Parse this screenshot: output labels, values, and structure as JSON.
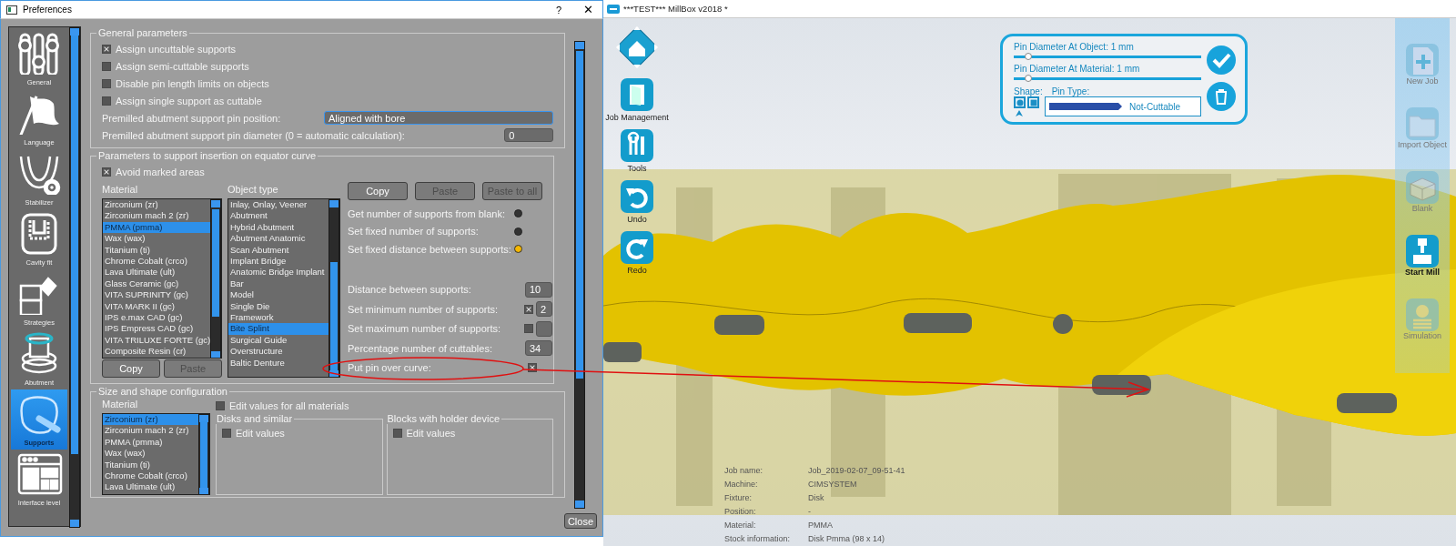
{
  "preferences": {
    "title": "Preferences",
    "help_button": "?",
    "close_button": "✕",
    "sidebar": [
      {
        "label": "General",
        "selected": false
      },
      {
        "label": "Language",
        "selected": false
      },
      {
        "label": "Stabilizer",
        "selected": false
      },
      {
        "label": "Cavity fit",
        "selected": false
      },
      {
        "label": "Strategies",
        "selected": false
      },
      {
        "label": "Abutment",
        "selected": false
      },
      {
        "label": "Supports",
        "selected": true
      },
      {
        "label": "Interface level",
        "selected": false
      }
    ],
    "general_parameters": {
      "title": "General parameters",
      "options": [
        {
          "label": "Assign uncuttable supports",
          "checked": true
        },
        {
          "label": "Assign semi-cuttable supports",
          "checked": false
        },
        {
          "label": "Disable pin length limits on objects",
          "checked": false
        },
        {
          "label": "Assign single support as cuttable",
          "checked": false
        }
      ],
      "pin_position": {
        "label": "Premilled abutment support pin position:",
        "value": "Aligned with bore"
      },
      "pin_diameter": {
        "label": "Premilled abutment support pin diameter (0 = automatic calculation):",
        "value": "0"
      }
    },
    "equator_curve": {
      "title": "Parameters to support insertion on equator curve",
      "avoid_marked_areas": {
        "label": "Avoid marked areas",
        "checked": true
      },
      "material": {
        "heading": "Material",
        "items": [
          {
            "label": "Zirconium (zr)",
            "selected": false
          },
          {
            "label": "Zirconium mach 2 (zr)",
            "selected": false
          },
          {
            "label": "PMMA (pmma)",
            "selected": true
          },
          {
            "label": "Wax (wax)",
            "selected": false
          },
          {
            "label": "Titanium (ti)",
            "selected": false
          },
          {
            "label": "Chrome Cobalt (crco)",
            "selected": false
          },
          {
            "label": "Lava Ultimate (ult)",
            "selected": false
          },
          {
            "label": "Glass Ceramic (gc)",
            "selected": false
          },
          {
            "label": "VITA SUPRINITY (gc)",
            "selected": false
          },
          {
            "label": "VITA MARK II (gc)",
            "selected": false
          },
          {
            "label": "IPS e.max CAD (gc)",
            "selected": false
          },
          {
            "label": "IPS Empress CAD (gc)",
            "selected": false
          },
          {
            "label": "VITA TRILUXE FORTE (gc)",
            "selected": false
          },
          {
            "label": "Composite Resin (cr)",
            "selected": false
          }
        ]
      },
      "list_buttons": [
        {
          "label": "Copy",
          "disabled": false
        },
        {
          "label": "Paste",
          "disabled": true
        }
      ],
      "object_type": {
        "heading": "Object type",
        "items": [
          {
            "label": "Inlay, Onlay, Veener",
            "selected": false
          },
          {
            "label": "Abutment",
            "selected": false
          },
          {
            "label": "Hybrid Abutment",
            "selected": false
          },
          {
            "label": "Abutment Anatomic",
            "selected": false
          },
          {
            "label": "Scan Abutment",
            "selected": false
          },
          {
            "label": "Implant Bridge",
            "selected": false
          },
          {
            "label": "Anatomic Bridge Implant",
            "selected": false
          },
          {
            "label": "Bar",
            "selected": false
          },
          {
            "label": "Model",
            "selected": false
          },
          {
            "label": "Single Die",
            "selected": false
          },
          {
            "label": "Framework",
            "selected": false
          },
          {
            "label": "Bite Splint",
            "selected": true
          },
          {
            "label": "Surgical Guide",
            "selected": false
          },
          {
            "label": "Overstructure",
            "selected": false
          },
          {
            "label": "Baltic Denture",
            "selected": false
          }
        ]
      },
      "actions": [
        {
          "label": "Copy",
          "disabled": false
        },
        {
          "label": "Paste",
          "disabled": true
        },
        {
          "label": "Paste to all",
          "disabled": true
        }
      ],
      "modes": [
        {
          "label": "Get number of supports from blank:",
          "selected": false
        },
        {
          "label": "Set fixed number of supports:",
          "selected": false
        },
        {
          "label": "Set fixed distance between supports:",
          "selected": true
        }
      ],
      "settings": [
        {
          "kind": "number",
          "label": "Distance between supports:",
          "value": "10"
        },
        {
          "kind": "check-number",
          "label": "Set minimum number of supports:",
          "checked": true,
          "value": "2"
        },
        {
          "kind": "check-number",
          "label": "Set maximum number of supports:",
          "checked": false
        },
        {
          "kind": "number",
          "label": "Percentage number of cuttables:",
          "value": "34"
        },
        {
          "kind": "check",
          "label": "Put pin over curve:",
          "checked": true
        }
      ]
    },
    "size_shape": {
      "title": "Size and shape configuration",
      "material": {
        "heading": "Material",
        "items": [
          {
            "label": "Zirconium (zr)",
            "selected": true
          },
          {
            "label": "Zirconium mach 2 (zr)",
            "selected": false
          },
          {
            "label": "PMMA (pmma)",
            "selected": false
          },
          {
            "label": "Wax (wax)",
            "selected": false
          },
          {
            "label": "Titanium (ti)",
            "selected": false
          },
          {
            "label": "Chrome Cobalt (crco)",
            "selected": false
          },
          {
            "label": "Lava Ultimate (ult)",
            "selected": false
          }
        ]
      },
      "edit_all": {
        "label": "Edit values for all materials",
        "checked": false
      },
      "groups": [
        {
          "title": "Disks and similar",
          "edit": {
            "label": "Edit values",
            "checked": false
          }
        },
        {
          "title": "Blocks with holder device",
          "edit": {
            "label": "Edit values",
            "checked": false
          }
        }
      ]
    },
    "footer_button": "Close"
  },
  "millbox": {
    "title": "***TEST*** MillBox v2018 *",
    "left_tools": [
      "Job Management",
      "Tools",
      "Undo",
      "Redo"
    ],
    "right_tools": [
      {
        "label": "New Job",
        "disabled": true
      },
      {
        "label": "Import Object",
        "disabled": true
      },
      {
        "label": "Blank",
        "disabled": true
      },
      {
        "label": "Start Mill",
        "disabled": false
      },
      {
        "label": "Simulation",
        "disabled": true
      }
    ],
    "pin_panel": {
      "sliders": [
        {
          "label": "Pin Diameter At Object: 1 mm",
          "level": 0.08
        },
        {
          "label": "Pin Diameter At Material: 1 mm",
          "level": 0.08
        }
      ],
      "shape_label": "Shape:",
      "shapes": [
        {
          "kind": "circle",
          "selected": true
        },
        {
          "kind": "square",
          "selected": false
        }
      ],
      "pin_type_label": "Pin Type:",
      "pin_type": "Not-Cuttable"
    },
    "job_info": [
      {
        "label": "Job name:",
        "value": "Job_2019-02-07_09-51-41"
      },
      {
        "label": "Machine:",
        "value": "CIMSYSTEM"
      },
      {
        "label": "Fixture:",
        "value": "Disk"
      },
      {
        "label": "Position:",
        "value": "-"
      },
      {
        "label": "Material:",
        "value": "PMMA"
      },
      {
        "label": "Stock information:",
        "value": "Disk Pmma (98 x 14)"
      }
    ]
  }
}
